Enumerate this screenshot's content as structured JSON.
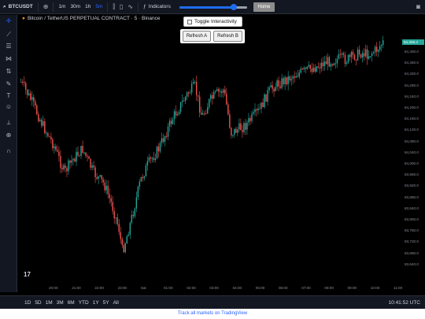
{
  "topbar": {
    "symbol": "BTCUSDT",
    "timeframes": [
      "1m",
      "30m",
      "1h",
      "5m"
    ],
    "active_timeframe": "5m",
    "indicators_label": "Indicators",
    "home_label": "Home",
    "slider_fraction": 0.8
  },
  "legend": {
    "title": "Bitcoin / TetherUS PERPETUAL CONTRACT · 5 · Binance"
  },
  "controls": {
    "toggle_label": "Toggle Interactivity",
    "refresh_a": "Refresh A",
    "refresh_b": "Refresh B"
  },
  "y_axis": {
    "labels": [
      "84,400.0",
      "84,360.0",
      "84,320.0",
      "84,280.0",
      "84,240.0",
      "84,200.0",
      "84,160.0",
      "84,120.0",
      "84,080.0",
      "84,040.0",
      "84,000.0",
      "83,960.0",
      "83,920.0",
      "83,880.0",
      "83,840.0",
      "83,800.0",
      "83,760.0",
      "83,720.0",
      "83,680.0",
      "83,640.0"
    ],
    "current_price": "84,359.4"
  },
  "x_axis": {
    "labels": [
      "20:00",
      "21:00",
      "22:00",
      "23:00",
      "Sat",
      "01:00",
      "02:00",
      "03:00",
      "04:00",
      "05:00",
      "06:00",
      "07:00",
      "08:00",
      "09:00",
      "10:00",
      "11:00"
    ]
  },
  "bottombar": {
    "ranges": [
      "1D",
      "5D",
      "1M",
      "3M",
      "6M",
      "YTD",
      "1Y",
      "5Y",
      "All"
    ],
    "clock": "10:41:52 UTC"
  },
  "footer": {
    "link": "Track all markets on TradingView"
  },
  "colors": {
    "up": "#26a69a",
    "down": "#ef5350",
    "accent": "#2962ff"
  }
}
